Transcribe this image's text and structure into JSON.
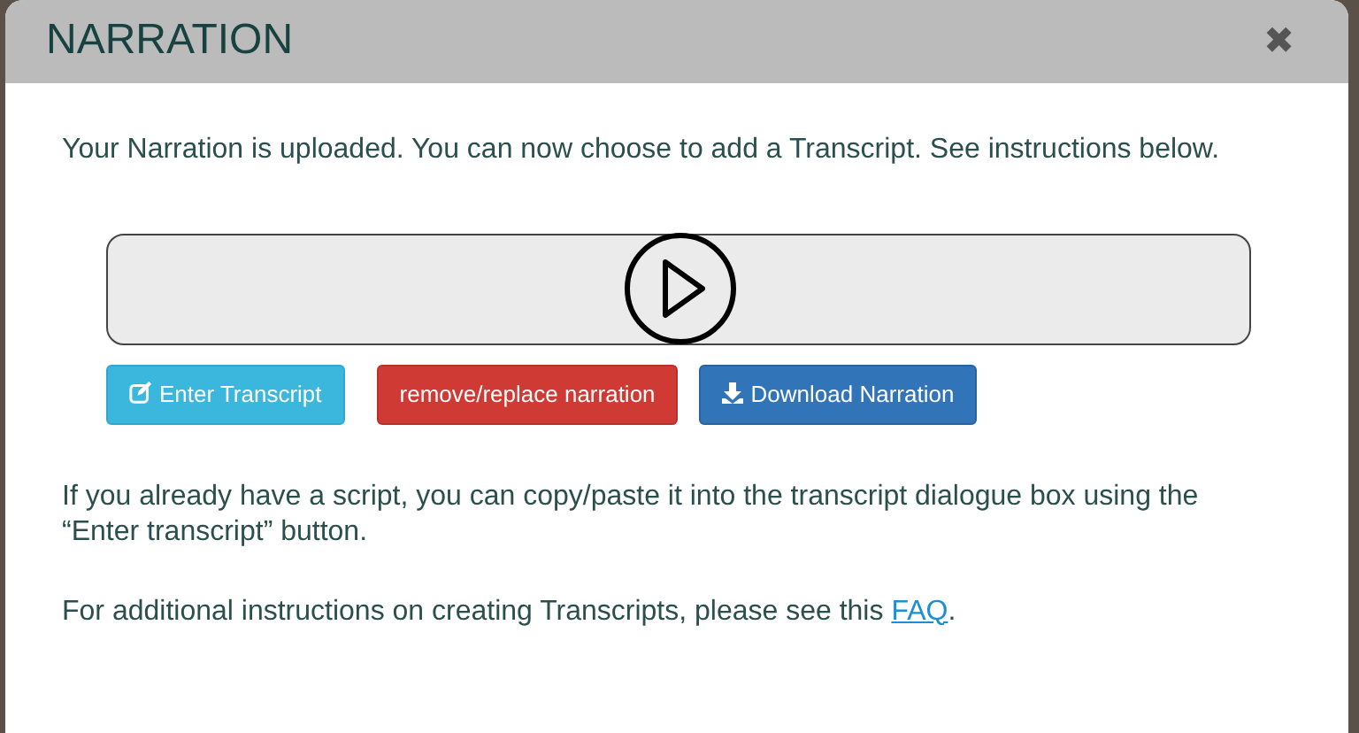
{
  "dialog": {
    "title": "NARRATION",
    "close": "✖"
  },
  "intro": "Your Narration is uploaded. You can now choose to add a Transcript. See instructions below.",
  "player": {
    "playing": false
  },
  "buttons": [
    {
      "label": "Enter Transcript",
      "kind": "enter"
    },
    {
      "label": "remove/replace narration",
      "kind": "remove"
    },
    {
      "label": "Download Narration",
      "kind": "download"
    }
  ],
  "paste_note": "If you already have a script, you can copy/paste it into the transcript dialogue box using the “Enter transcript” button.",
  "faq_note": {
    "before": "For additional instructions on creating Transcripts, please see this ",
    "link": "FAQ",
    "after": "."
  }
}
